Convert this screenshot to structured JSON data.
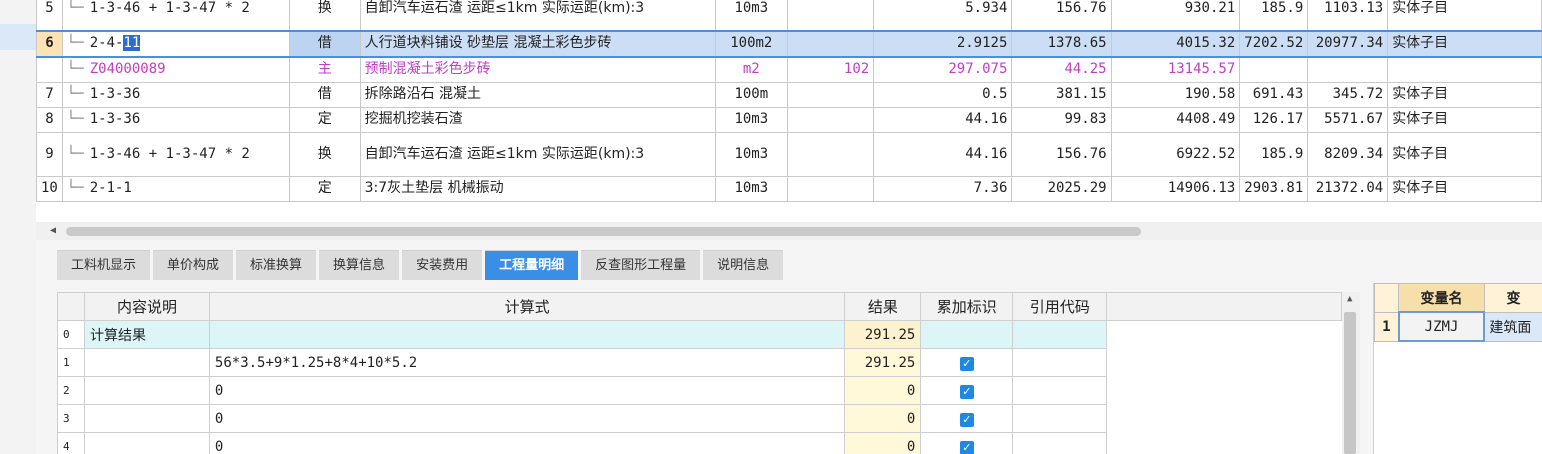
{
  "upper_rows": [
    {
      "row": "5",
      "code": "1-3-46 + 1-3-47 * 2",
      "type": "换",
      "name": "自卸汽车运石渣 运距≤1km  实际运距(km):3",
      "unit": "10m3",
      "blank": "",
      "qty": "5.934",
      "price": "156.76",
      "total": "930.21",
      "col9": "185.9",
      "col10": "1103.13",
      "category": "实体子目"
    },
    {
      "row": "6",
      "code_prefix": "2-4-",
      "code_highlight": "11",
      "type": "借",
      "name": "人行道块料铺设 砂垫层 混凝土彩色步砖",
      "unit": "100m2",
      "blank": "",
      "qty": "2.9125",
      "price": "1378.65",
      "total": "4015.32",
      "col9": "7202.52",
      "col10": "20977.34",
      "category": "实体子目"
    },
    {
      "row": "",
      "code": "Z04000089",
      "type": "主",
      "name": "预制混凝土彩色步砖",
      "unit": "m2",
      "blank": "102",
      "qty": "297.075",
      "price": "44.25",
      "total": "13145.57",
      "col9": "",
      "col10": "",
      "category": ""
    },
    {
      "row": "7",
      "code": "1-3-36",
      "type": "借",
      "name": "拆除路沿石 混凝土",
      "unit": "100m",
      "blank": "",
      "qty": "0.5",
      "price": "381.15",
      "total": "190.58",
      "col9": "691.43",
      "col10": "345.72",
      "category": "实体子目"
    },
    {
      "row": "8",
      "code": "1-3-36",
      "type": "定",
      "name": "挖掘机挖装石渣",
      "unit": "10m3",
      "blank": "",
      "qty": "44.16",
      "price": "99.83",
      "total": "4408.49",
      "col9": "126.17",
      "col10": "5571.67",
      "category": "实体子目"
    },
    {
      "row": "9",
      "code": "1-3-46 + 1-3-47 * 2",
      "type": "换",
      "name": "自卸汽车运石渣 运距≤1km  实际运距(km):3",
      "unit": "10m3",
      "blank": "",
      "qty": "44.16",
      "price": "156.76",
      "total": "6922.52",
      "col9": "185.9",
      "col10": "8209.34",
      "category": "实体子目"
    },
    {
      "row": "10",
      "code": "2-1-1",
      "type": "定",
      "name": "3:7灰土垫层 机械振动",
      "unit": "10m3",
      "blank": "",
      "qty": "7.36",
      "price": "2025.29",
      "total": "14906.13",
      "col9": "2903.81",
      "col10": "21372.04",
      "category": "实体子目"
    }
  ],
  "tabs": [
    "工料机显示",
    "单价构成",
    "标准换算",
    "换算信息",
    "安装费用",
    "工程量明细",
    "反查图形工程量",
    "说明信息"
  ],
  "active_tab": "工程量明细",
  "detail": {
    "headers": [
      "内容说明",
      "计算式",
      "结果",
      "累加标识",
      "引用代码"
    ],
    "rows": [
      {
        "no": "0",
        "desc": "计算结果",
        "formula": "",
        "result": "291.25",
        "checked": false,
        "code": ""
      },
      {
        "no": "1",
        "desc": "",
        "formula": "56*3.5+9*1.25+8*4+10*5.2",
        "result": "291.25",
        "checked": true,
        "code": ""
      },
      {
        "no": "2",
        "desc": "",
        "formula": "0",
        "result": "0",
        "checked": true,
        "code": ""
      },
      {
        "no": "3",
        "desc": "",
        "formula": "0",
        "result": "0",
        "checked": true,
        "code": ""
      },
      {
        "no": "4",
        "desc": "",
        "formula": "0",
        "result": "0",
        "checked": true,
        "code": ""
      }
    ]
  },
  "variables": {
    "headers": [
      "变量名",
      "变"
    ],
    "rows": [
      {
        "no": "1",
        "name": "JZMJ",
        "desc": "建筑面"
      }
    ]
  },
  "icons": {
    "check": "✓",
    "arrow_left": "◀",
    "arrow_up": "▲"
  }
}
